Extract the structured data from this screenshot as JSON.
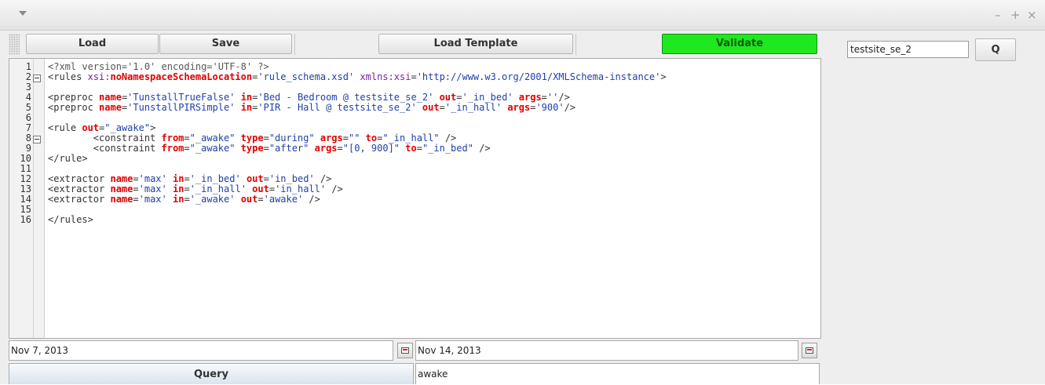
{
  "toolbar": {
    "load_label": "Load",
    "save_label": "Save",
    "load_template_label": "Load Template",
    "validate_label": "Validate"
  },
  "search": {
    "value": "testsite_se_2",
    "button_label": "Q"
  },
  "editor": {
    "line_numbers": [
      "1",
      "2",
      "3",
      "4",
      "5",
      "6",
      "7",
      "8",
      "9",
      "10",
      "11",
      "12",
      "13",
      "14",
      "15",
      "16"
    ],
    "lines": [
      "<?xml version='1.0' encoding='UTF-8' ?>",
      "<rules xsi:noNamespaceSchemaLocation='rule_schema.xsd' xmlns:xsi='http://www.w3.org/2001/XMLSchema-instance'>",
      "",
      "<preproc name='TunstallTrueFalse' in='Bed - Bedroom @ testsite_se_2' out='_in_bed' args=''/>",
      "<preproc name='TunstallPIRSimple' in='PIR - Hall @ testsite_se_2' out='_in_hall' args='900'/>",
      "",
      "<rule out=\"_awake\">",
      "        <constraint from=\"_awake\" type=\"during\" args=\"\" to=\"_in_hall\" />",
      "        <constraint from=\"_awake\" type=\"after\" args=\"[0, 900]\" to=\"_in_bed\" />",
      "</rule>",
      "",
      "<extractor name='max' in='_in_bed' out='in_bed' />",
      "<extractor name='max' in='_in_hall' out='in_hall' />",
      "<extractor name='max' in='_awake' out='awake' />",
      "",
      "</rules>"
    ]
  },
  "dates": {
    "start": "Nov 7, 2013",
    "end": "Nov 14, 2013"
  },
  "query": {
    "button_label": "Query",
    "result": "awake"
  },
  "colors": {
    "validate_bg": "#1fe81f",
    "attr_name": "#e00000",
    "attr_value": "#1f3fa8",
    "namespace": "#7a1fa0"
  }
}
